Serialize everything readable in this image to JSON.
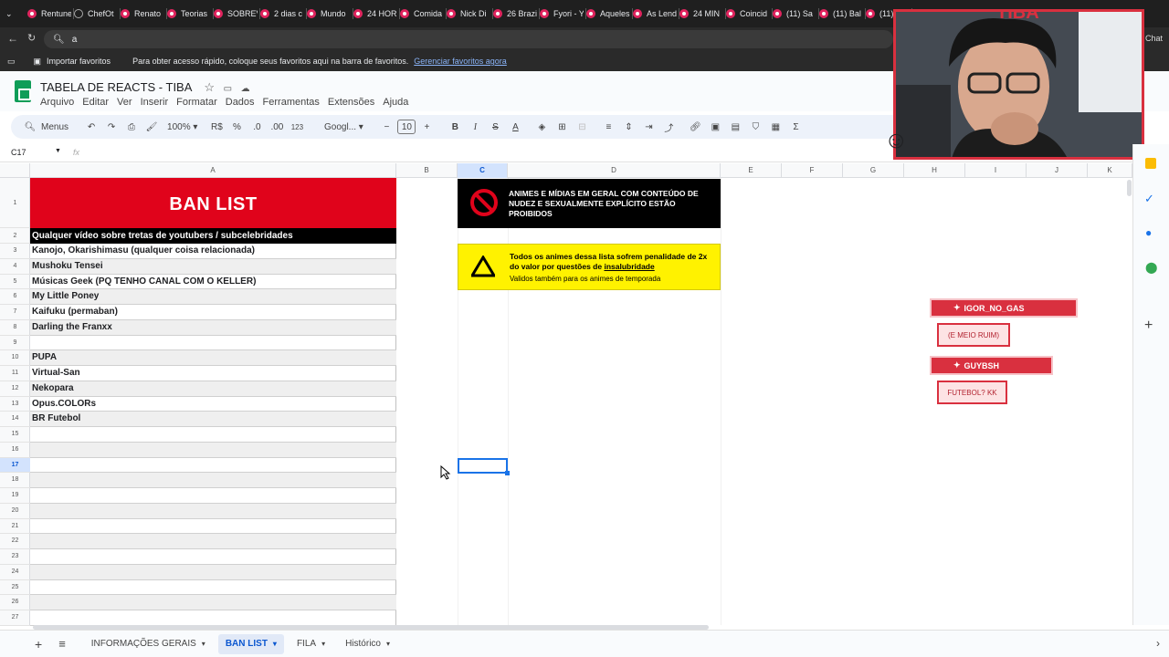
{
  "browser": {
    "tabs": [
      "Rentune",
      "ChefOt",
      "Renato",
      "Teorias",
      "SOBREV",
      "2 dias c",
      "Mundo",
      "24 HOR",
      "Comida",
      "Nick Di",
      "26 Brazi",
      "Fyori - Y",
      "Aqueles",
      "As Lend",
      "24 MIN",
      "Coincid",
      "(11) Sa",
      "(11) Bal",
      "(11)"
    ],
    "address": "a",
    "bookmarks": {
      "import_label": "Importar favoritos",
      "hint": "Para obter acesso rápido, coloque seus favoritos aqui na barra de favoritos.",
      "manage_link": "Gerenciar favoritos agora"
    },
    "chat_label": "Chat"
  },
  "doc": {
    "title": "TABELA DE REACTS - TIBA",
    "menu": [
      "Arquivo",
      "Editar",
      "Ver",
      "Inserir",
      "Formatar",
      "Dados",
      "Ferramentas",
      "Extensões",
      "Ajuda"
    ]
  },
  "toolbar": {
    "search_label": "Menus",
    "zoom": "100%",
    "currency": "R$",
    "percent": "%",
    "dec_less": ".0",
    "dec_more": ".00",
    "number_fmt": "123",
    "font": "Googl...",
    "font_size": "10",
    "bold": "B",
    "italic": "I",
    "strike": "S",
    "text_color": "A",
    "sum": "Σ",
    "minus": "−",
    "plus": "+"
  },
  "formula": {
    "cell_ref": "C17",
    "fx": "fx"
  },
  "columns": [
    "A",
    "B",
    "C",
    "D",
    "E",
    "F",
    "G",
    "H",
    "I",
    "J",
    "K"
  ],
  "rows": [
    "1",
    "2",
    "3",
    "4",
    "5",
    "6",
    "7",
    "8",
    "9",
    "10",
    "11",
    "12",
    "13",
    "14",
    "15",
    "16",
    "17",
    "18",
    "19",
    "20",
    "21",
    "22",
    "23",
    "24",
    "25",
    "26",
    "27"
  ],
  "banlist": {
    "header": "BAN LIST",
    "row2": "Qualquer vídeo sobre tretas de youtubers / subcelebridades",
    "items": [
      "Kanojo, Okarishimasu (qualquer coisa relacionada)",
      "Mushoku Tensei",
      "Músicas Geek (PQ TENHO CANAL COM O KELLER)",
      "My Little Poney",
      "Kaifuku (permaban)",
      "Darling the Franxx",
      "",
      "PUPA",
      "Virtual-San",
      "Nekopara",
      "Opus.COLORs",
      "BR Futebol"
    ]
  },
  "notices": {
    "nude": "ANIMES E MÍDIAS EM GERAL COM CONTEÚDO DE NUDEZ E SEXUALMENTE EXPLÍCITO ESTÃO PROIBIDOS",
    "penalty_a": "Todos os animes dessa lista sofrem penalidade de 2x do valor por questões de",
    "penalty_b": "insalubridade",
    "penalty_note": "Validos também para os animes de temporada"
  },
  "chat": [
    {
      "user": "IGOR_NO_GAS",
      "message": "(E MEIO RUIM)"
    },
    {
      "user": "GUYBSH",
      "message": "FUTEBOL? KK"
    }
  ],
  "webcam": {
    "overlay_text": "TIBA"
  },
  "sheet_tabs": [
    "INFORMAÇÕES GERAIS",
    "BAN LIST",
    "FILA",
    "Histórico"
  ],
  "active_sheet": "BAN LIST",
  "colors": {
    "red": "#e0031b",
    "yellow": "#fff200",
    "chat_red": "#d9303f",
    "selection": "#1a73e8"
  }
}
